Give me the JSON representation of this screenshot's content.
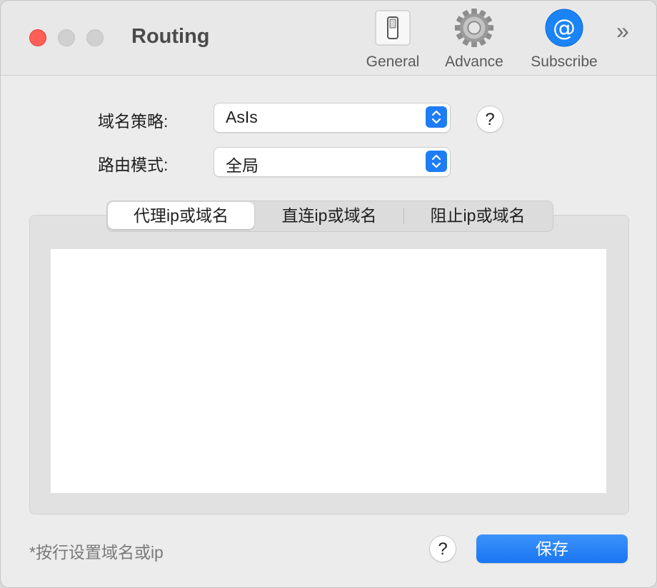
{
  "window": {
    "title": "Routing"
  },
  "toolbar": {
    "items": [
      {
        "label": "General",
        "icon": "switch-icon"
      },
      {
        "label": "Advance",
        "icon": "gear-icon"
      },
      {
        "label": "Subscribe",
        "icon": "at-sign-icon"
      }
    ],
    "overflow": "»"
  },
  "form": {
    "domain_strategy": {
      "label": "域名策略:",
      "value": "AsIs",
      "help": "?"
    },
    "routing_mode": {
      "label": "路由模式:",
      "value": "全局"
    }
  },
  "tabs": [
    {
      "label": "代理ip或域名",
      "selected": true
    },
    {
      "label": "直连ip或域名",
      "selected": false
    },
    {
      "label": "阻止ip或域名",
      "selected": false
    }
  ],
  "editor": {
    "value": ""
  },
  "footer": {
    "note": "*按行设置域名或ip",
    "help": "?",
    "save_label": "保存"
  },
  "colors": {
    "accent": "#1e7cf5",
    "close": "#fe5f57"
  }
}
